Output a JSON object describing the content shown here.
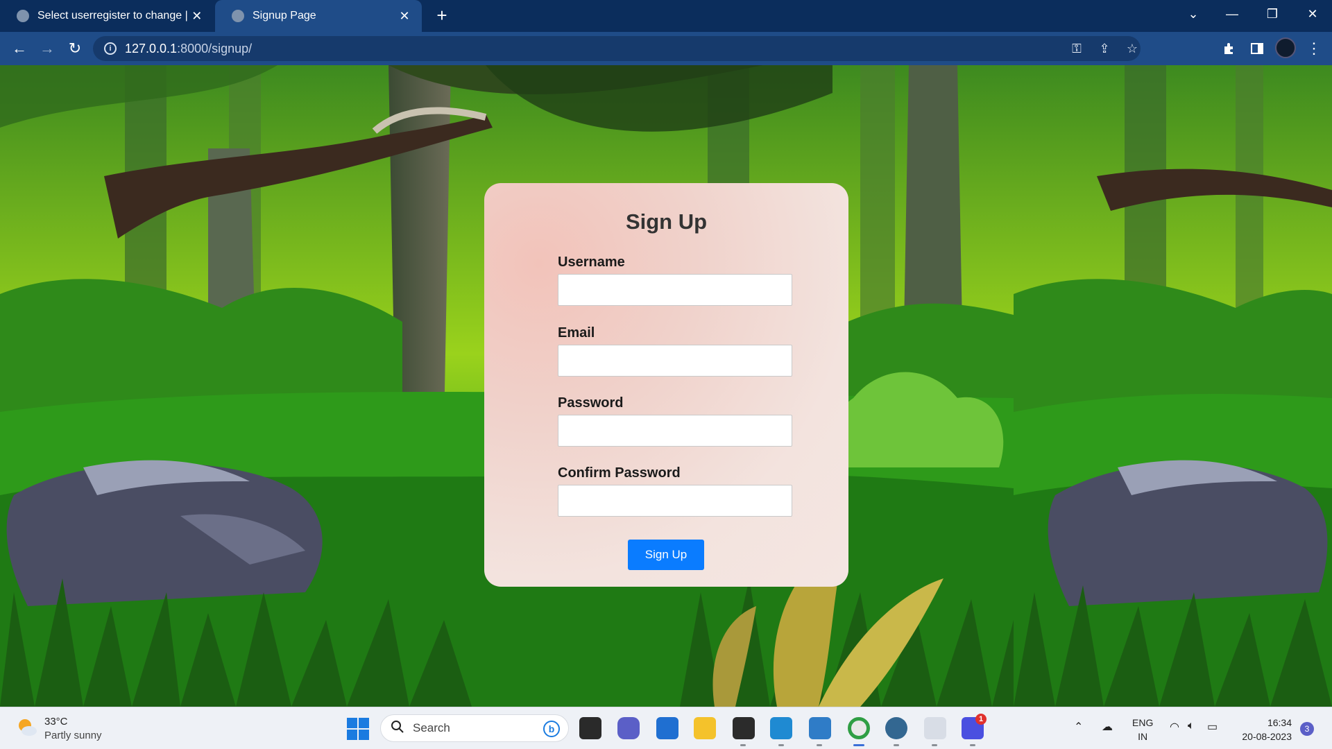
{
  "browser": {
    "tabs": [
      {
        "title": "Select userregister to change | Dj"
      },
      {
        "title": "Signup Page"
      }
    ],
    "url_host": "127.0.0.1",
    "url_path": ":8000/signup/"
  },
  "signup": {
    "title": "Sign Up",
    "username_label": "Username",
    "email_label": "Email",
    "password_label": "Password",
    "confirm_label": "Confirm Password",
    "submit_label": "Sign Up",
    "username_value": "",
    "email_value": "",
    "password_value": "",
    "confirm_value": ""
  },
  "taskbar": {
    "weather_temp": "33°C",
    "weather_condition": "Partly sunny",
    "search_placeholder": "Search",
    "lang_line1": "ENG",
    "lang_line2": "IN",
    "time": "16:34",
    "date": "20-08-2023",
    "notification_count": "3",
    "app_badge": "1"
  },
  "colors": {
    "title_bar": "#0b2d5c",
    "toolbar": "#1f4c88",
    "submit_button": "#0a7cff"
  }
}
